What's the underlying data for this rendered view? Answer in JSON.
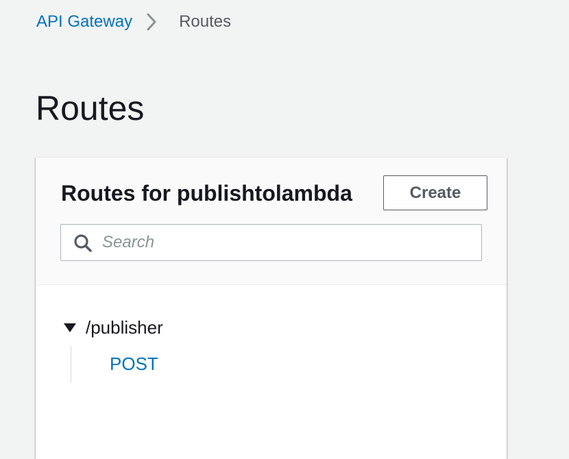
{
  "breadcrumb": {
    "items": [
      {
        "label": "API Gateway"
      },
      {
        "label": "Routes"
      }
    ]
  },
  "page": {
    "title": "Routes"
  },
  "routes_panel": {
    "title": "Routes for publishtolambda",
    "create_label": "Create",
    "search": {
      "placeholder": "Search",
      "value": ""
    },
    "tree": [
      {
        "path": "/publisher",
        "expanded": true,
        "methods": [
          "POST"
        ]
      }
    ]
  },
  "colors": {
    "page_background": "#f2f3f3",
    "link": "#0073bb",
    "text": "#16191f",
    "secondary_text": "#545b64",
    "placeholder": "#879596",
    "panel_header_background": "#fafafa"
  },
  "icons": {
    "breadcrumb_separator": "chevron-right-icon",
    "search": "search-icon",
    "tree_toggle": "caret-down-icon"
  }
}
